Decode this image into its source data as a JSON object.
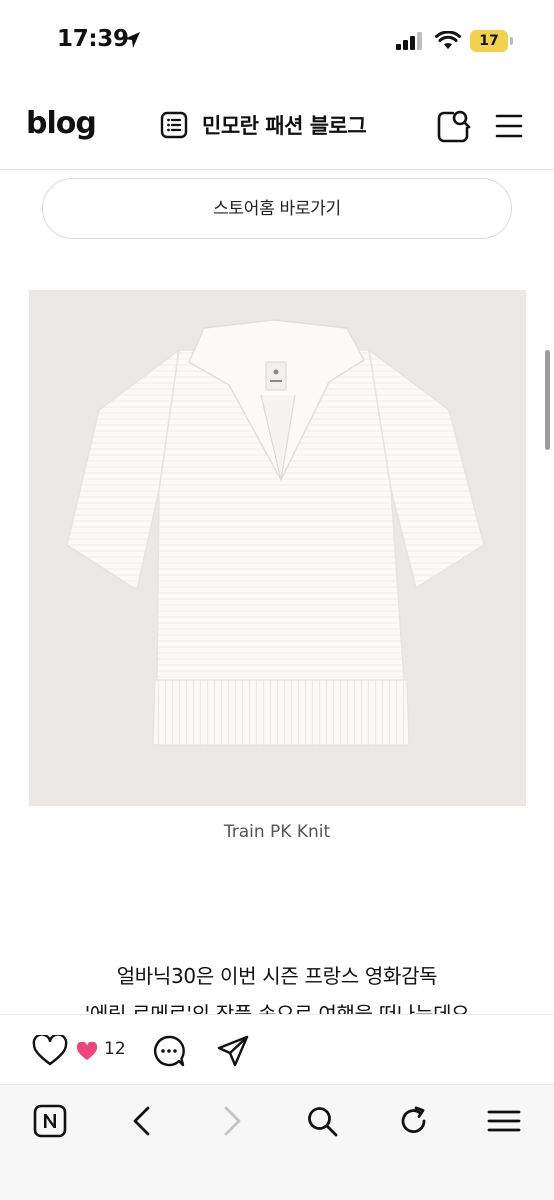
{
  "status_bar": {
    "time": "17:39",
    "battery": "17"
  },
  "header": {
    "logo": "blog",
    "blog_title": "민모란 패션 블로그",
    "icons": [
      "list-icon",
      "search-icon",
      "menu-icon"
    ]
  },
  "store_button": {
    "label": "스토어홈 바로가기"
  },
  "post": {
    "image_caption": "Train PK Knit",
    "paragraphs": [
      "얼바닉30은 이번 시즌 프랑스 영화감독",
      "'에릭 로메르'의 작품 속으로 여행을 떠나는데요"
    ]
  },
  "actions": {
    "like_count": "12",
    "icons": [
      "heart-outline-icon",
      "heart-filled-icon",
      "comment-icon",
      "share-icon"
    ],
    "accent_color": "#f0457a"
  },
  "browser_toolbar": {
    "icons": [
      "naver-home-icon",
      "back-icon",
      "forward-icon",
      "search-icon",
      "reload-icon",
      "menu-icon"
    ]
  }
}
